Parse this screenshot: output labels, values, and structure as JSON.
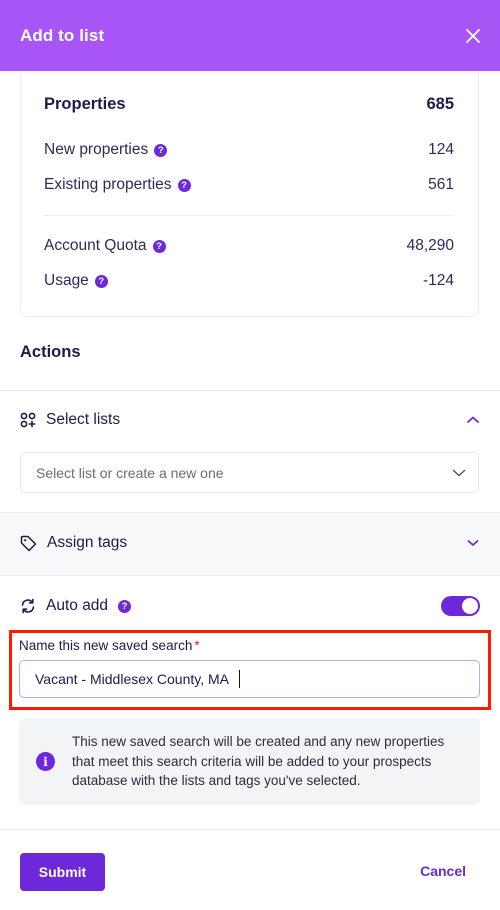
{
  "header": {
    "title": "Add to list",
    "close_icon": "close-icon",
    "background": "#a855f7"
  },
  "summary": {
    "properties": {
      "label": "Properties",
      "value": "685"
    },
    "new_properties": {
      "label": "New properties",
      "value": "124",
      "help": "?"
    },
    "existing_properties": {
      "label": "Existing properties",
      "value": "561",
      "help": "?"
    },
    "account_quota": {
      "label": "Account Quota",
      "value": "48,290",
      "help": "?"
    },
    "usage": {
      "label": "Usage",
      "value": "-124",
      "help": "?"
    }
  },
  "actions": {
    "title": "Actions",
    "select_lists": {
      "label": "Select lists",
      "icon": "apps-add-icon",
      "expanded": true,
      "placeholder": "Select list or create a new one"
    },
    "assign_tags": {
      "label": "Assign tags",
      "icon": "tag-icon",
      "expanded": false
    },
    "auto_add": {
      "label": "Auto add",
      "icon": "refresh-icon",
      "help": "?",
      "enabled": true
    }
  },
  "saved_search": {
    "label": "Name this new saved search",
    "required_mark": "*",
    "value": "Vacant - Middlesex County, MA"
  },
  "info": {
    "icon": "i",
    "text": "This new saved search will be created and any new properties that meet this search criteria will be added to your prospects database with the lists and tags you've selected."
  },
  "footer": {
    "submit_label": "Submit",
    "cancel_label": "Cancel"
  },
  "colors": {
    "accent": "#6d28d9",
    "header": "#a855f7",
    "highlight": "#ff1a00"
  }
}
